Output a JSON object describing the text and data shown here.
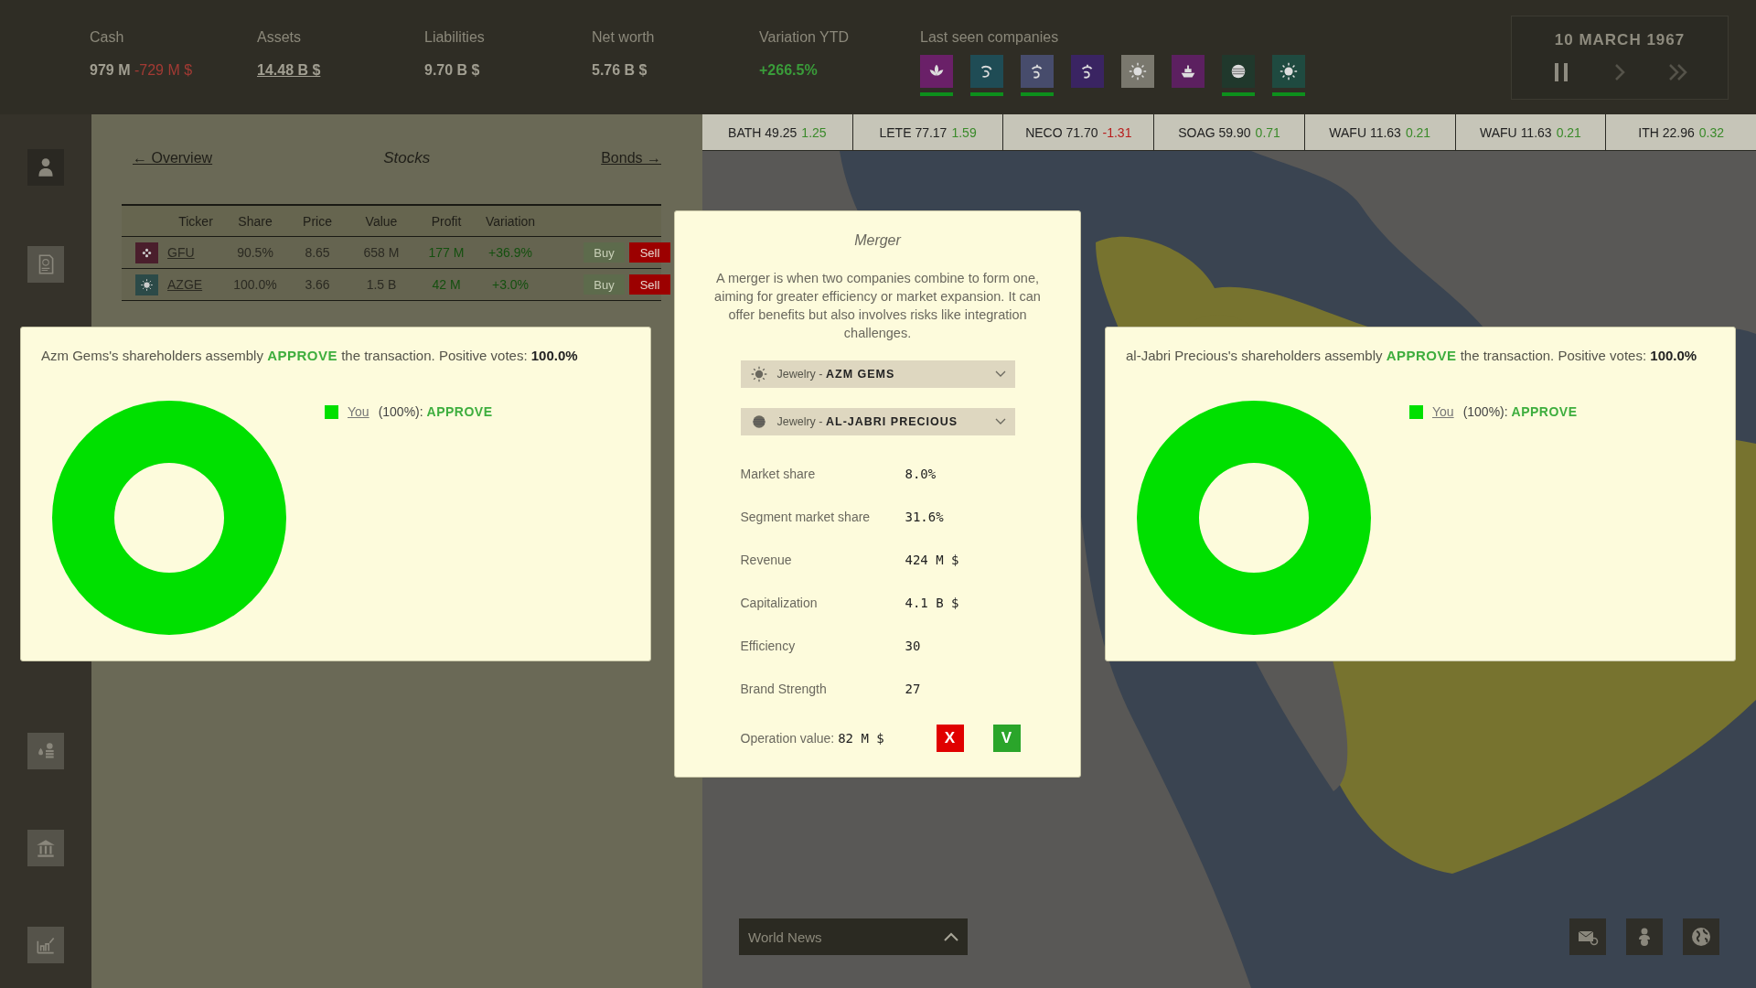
{
  "top_bar": {
    "stats": [
      {
        "label": "Cash",
        "value": "979 M",
        "delta": "-729 M $",
        "color": "#a19e91",
        "link": false
      },
      {
        "label": "Assets",
        "value": "14.48 B $",
        "color": "#a19e91",
        "link": true
      },
      {
        "label": "Liabilities",
        "value": "9.70 B $",
        "color": "#a19e91",
        "link": false
      },
      {
        "label": "Net worth",
        "value": "5.76 B $",
        "color": "#a19e91",
        "link": false
      },
      {
        "label": "Variation YTD",
        "value": "+266.5%",
        "color": "#3a9c3a",
        "link": false
      }
    ],
    "last_seen": {
      "label": "Last seen companies",
      "companies": [
        {
          "kind": "lotus",
          "color": "#6a2068",
          "highlighted": true
        },
        {
          "kind": "wave",
          "color": "#1f4c55",
          "highlighted": true
        },
        {
          "kind": "curl",
          "color": "#474c6c",
          "highlighted": true
        },
        {
          "kind": "curl",
          "color": "#3a2462",
          "highlighted": false
        },
        {
          "kind": "sun",
          "color": "#7a786e",
          "highlighted": false
        },
        {
          "kind": "boat",
          "color": "#5c2060",
          "highlighted": false
        },
        {
          "kind": "globe",
          "color": "#20382c",
          "highlighted": true
        },
        {
          "kind": "sun",
          "color": "#1f4a40",
          "highlighted": true
        }
      ]
    },
    "date": "10 MARCH 1967"
  },
  "sidebar": {
    "items": [
      {
        "kind": "person",
        "selected": true
      },
      {
        "kind": "document",
        "selected": false
      },
      {
        "kind": "coins",
        "selected": false
      },
      {
        "kind": "bank",
        "selected": false
      },
      {
        "kind": "chart",
        "selected": false
      }
    ]
  },
  "stocks_panel": {
    "prev_link": "← Overview",
    "title": "Stocks",
    "next_link": "Bonds →",
    "columns": [
      "Ticker",
      "Share",
      "Price",
      "Value",
      "Profit",
      "Variation"
    ],
    "rows": [
      {
        "kind": "flower",
        "color": "#4a1e2c",
        "ticker": "GFU",
        "share": "90.5%",
        "price": "8.65",
        "value": "658 M",
        "profit": "177 M",
        "variation": "+36.9%",
        "buy": "Buy",
        "buy_disabled": true,
        "sell": "Sell"
      },
      {
        "kind": "sun",
        "color": "#2c4a48",
        "ticker": "AZGE",
        "share": "100.0%",
        "price": "3.66",
        "value": "1.5 B",
        "profit": "42 M",
        "variation": "+3.0%",
        "buy": "Buy",
        "buy_disabled": true,
        "sell": "Sell"
      }
    ]
  },
  "ticker_bar": [
    {
      "symbol": "BATH",
      "price": "49.25",
      "change": "1.25",
      "color": "#3a8a2a"
    },
    {
      "symbol": "LETE",
      "price": "77.17",
      "change": "1.59",
      "color": "#3a8a2a"
    },
    {
      "symbol": "NECO",
      "price": "71.70",
      "change": "-1.31",
      "color": "#b81c1c"
    },
    {
      "symbol": "SOAG",
      "price": "59.90",
      "change": "0.71",
      "color": "#3a8a2a"
    },
    {
      "symbol": "WAFU",
      "price": "11.63",
      "change": "0.21",
      "color": "#3a8a2a"
    },
    {
      "symbol": "WAFU",
      "price": "11.63",
      "change": "0.21",
      "color": "#3a8a2a"
    },
    {
      "symbol": "ITH",
      "price": "22.96",
      "change": "0.32",
      "color": "#3a8a2a"
    }
  ],
  "vote_dialogs": [
    {
      "message_before": "Azm Gems's shareholders assembly",
      "verdict": "APPROVE",
      "approved": true,
      "message_after": "the transaction. Positive votes:",
      "votes": "100.0%",
      "legend": [
        {
          "name": "You",
          "share": "(100%):",
          "vote": "APPROVE",
          "approved": true,
          "color": "#00e000"
        }
      ]
    },
    {
      "message_before": "al-Jabri Precious's shareholders assembly",
      "verdict": "APPROVE",
      "approved": true,
      "message_after": "the transaction. Positive votes:",
      "votes": "100.0%",
      "legend": [
        {
          "name": "You",
          "share": "(100%):",
          "vote": "APPROVE",
          "approved": true,
          "color": "#00e000"
        }
      ]
    }
  ],
  "merger": {
    "title": "Merger",
    "description": "A merger is when two companies combine to form one, aiming for greater efficiency or market expansion. It can offer benefits but also involves risks like integration challenges.",
    "selects": [
      {
        "kind": "sun",
        "sector": "Jewelry -",
        "company": "AZM GEMS"
      },
      {
        "kind": "globe",
        "sector": "Jewelry -",
        "company": "AL-JABRI PRECIOUS"
      }
    ],
    "stats": [
      {
        "label": "Market share",
        "value": "8.0%"
      },
      {
        "label": "Segment market share",
        "value": "31.6%"
      },
      {
        "label": "Revenue",
        "value": "424 M $"
      },
      {
        "label": "Capitalization",
        "value": "4.1 B $"
      },
      {
        "label": "Efficiency",
        "value": "30"
      },
      {
        "label": "Brand Strength",
        "value": "27"
      }
    ],
    "operation_label": "Operation value:",
    "operation_value": "82 M $",
    "reject": "X",
    "accept": "V"
  },
  "world_news": {
    "label": "World News"
  },
  "bottom_icons": [
    {
      "kind": "mail-gear"
    },
    {
      "kind": "person-coin"
    },
    {
      "kind": "globe"
    }
  ]
}
